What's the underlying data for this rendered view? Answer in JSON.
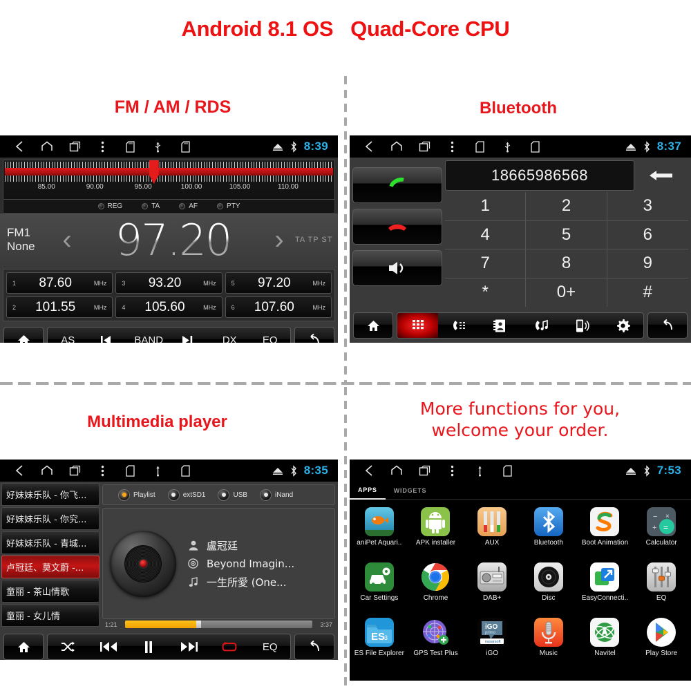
{
  "headline": "Android 8.1 OS   Quad-Core CPU",
  "captions": {
    "radio": "FM / AM / RDS",
    "bluetooth": "Bluetooth",
    "media": "Multimedia player",
    "apps": "More functions for you,\nwelcome your order."
  },
  "colors": {
    "accent_red": "#e8151b",
    "clock_blue": "#2cb2e8",
    "band_red": "#e21b1b",
    "progress_yellow": "#ffc21a"
  },
  "statusbar": {
    "icons": [
      "back-icon",
      "home-icon",
      "recents-icon",
      "overflow-icon",
      "sdcard-icon",
      "usb-icon",
      "sdcard2-icon"
    ],
    "right_icons": [
      "eject-icon",
      "bluetooth-icon"
    ],
    "clock_radio": "8:39",
    "clock_bt": "8:37",
    "clock_media": "8:35",
    "clock_apps": "7:53"
  },
  "radio": {
    "scale_labels": [
      "85.00",
      "90.00",
      "95.00",
      "100.00",
      "105.00",
      "110.00"
    ],
    "scale_positions": [
      13,
      27.6,
      42.2,
      56.8,
      71.4,
      86
    ],
    "cursor_percent": 44,
    "rds": [
      {
        "label": "REG",
        "on": false
      },
      {
        "label": "TA",
        "on": false
      },
      {
        "label": "AF",
        "on": false
      },
      {
        "label": "PTY",
        "on": false
      }
    ],
    "band": "FM1",
    "station_name": "None",
    "frequency": "97.20",
    "prev_icon": "chevron-left-icon",
    "next_icon": "chevron-right-icon",
    "flags": "TA TP ST",
    "presets": [
      {
        "index": "1",
        "value": "87.60",
        "unit": "MHz"
      },
      {
        "index": "3",
        "value": "93.20",
        "unit": "MHz"
      },
      {
        "index": "5",
        "value": "97.20",
        "unit": "MHz"
      },
      {
        "index": "2",
        "value": "101.55",
        "unit": "MHz"
      },
      {
        "index": "4",
        "value": "105.60",
        "unit": "MHz"
      },
      {
        "index": "6",
        "value": "107.60",
        "unit": "MHz"
      }
    ],
    "toolbar": {
      "home": "home-icon",
      "items": [
        "AS",
        "prev-track-icon",
        "BAND",
        "next-track-icon",
        "DX",
        "EQ"
      ],
      "back": "return-icon"
    }
  },
  "bluetooth": {
    "call_buttons": [
      "call-answer-icon",
      "call-end-icon",
      "mute-volume-icon"
    ],
    "number": "18665986568",
    "backspace": "backspace-arrow-icon",
    "keys": [
      "1",
      "2",
      "3",
      "4",
      "5",
      "6",
      "7",
      "8",
      "9",
      "*",
      "0+",
      "#"
    ],
    "toolbar": {
      "home": "home-icon",
      "items": [
        "dialpad-icon",
        "call-log-icon",
        "contacts-book-icon",
        "call-music-icon",
        "phone-sync-icon",
        "gear-icon"
      ],
      "active_index": 0,
      "back": "return-icon"
    }
  },
  "media": {
    "playlist": [
      {
        "title": "好妹妹乐队 - 你飞...",
        "selected": false
      },
      {
        "title": "好妹妹乐队 - 你究...",
        "selected": false
      },
      {
        "title": "好妹妹乐队 - 青城...",
        "selected": false
      },
      {
        "title": "卢冠廷、莫文蔚 -...",
        "selected": true
      },
      {
        "title": "童丽 - 茶山情歌",
        "selected": false
      },
      {
        "title": "童丽 - 女儿情",
        "selected": false
      }
    ],
    "sources": [
      {
        "label": "Playlist",
        "on": true
      },
      {
        "label": "extSD1",
        "on": false
      },
      {
        "label": "USB",
        "on": false
      },
      {
        "label": "iNand",
        "on": false
      }
    ],
    "artist": "盧冠廷",
    "album": "Beyond Imagin...",
    "track": "一生所愛 (One...",
    "artist_icon": "person-icon",
    "album_icon": "disc-icon",
    "track_icon": "music-note-icon",
    "elapsed": "1:21",
    "duration": "3:37",
    "progress_percent": 38,
    "toolbar": {
      "home": "home-icon",
      "items": [
        "shuffle-icon",
        "previous-icon",
        "pause-icon",
        "next-icon",
        "repeat-icon",
        "EQ"
      ],
      "back": "return-icon"
    }
  },
  "apps": {
    "tabs": [
      {
        "label": "APPS",
        "active": true
      },
      {
        "label": "WIDGETS",
        "active": false
      }
    ],
    "items": [
      {
        "label": "aniPet Aquari..",
        "icon": "anipet-aquarium-icon"
      },
      {
        "label": "APK installer",
        "icon": "apk-installer-icon"
      },
      {
        "label": "AUX",
        "icon": "aux-cable-icon"
      },
      {
        "label": "Bluetooth",
        "icon": "bluetooth-icon"
      },
      {
        "label": "Boot Animation",
        "icon": "boot-animation-icon"
      },
      {
        "label": "Calculator",
        "icon": "calculator-icon"
      },
      {
        "label": "Car Settings",
        "icon": "car-settings-icon"
      },
      {
        "label": "Chrome",
        "icon": "chrome-icon"
      },
      {
        "label": "DAB+",
        "icon": "dab-radio-icon"
      },
      {
        "label": "Disc",
        "icon": "disc-icon"
      },
      {
        "label": "EasyConnecti..",
        "icon": "easyconnection-icon"
      },
      {
        "label": "EQ",
        "icon": "equalizer-icon"
      },
      {
        "label": "ES File Explorer",
        "icon": "es-file-explorer-icon"
      },
      {
        "label": "GPS Test Plus",
        "icon": "gps-test-plus-icon"
      },
      {
        "label": "iGO",
        "icon": "igo-primo-icon"
      },
      {
        "label": "Music",
        "icon": "music-microphone-icon"
      },
      {
        "label": "Navitel",
        "icon": "navitel-icon"
      },
      {
        "label": "Play Store",
        "icon": "play-store-icon"
      }
    ]
  }
}
